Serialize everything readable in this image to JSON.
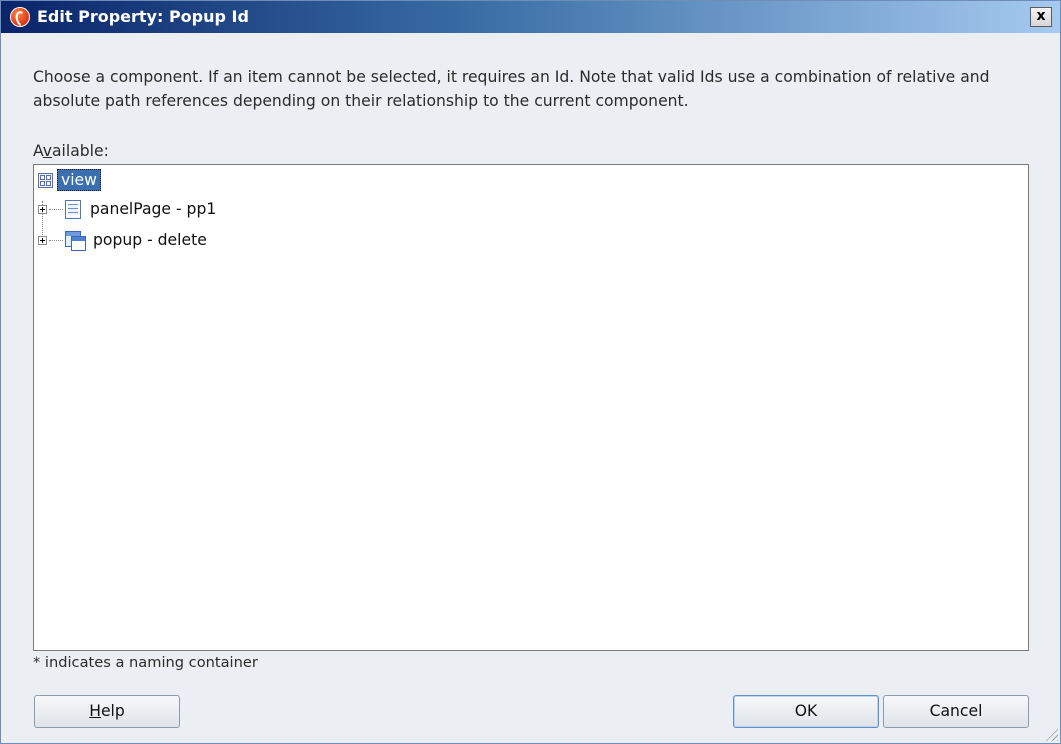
{
  "window": {
    "title": "Edit Property: Popup Id",
    "close_label": "x"
  },
  "description": "Choose a component. If an item cannot be selected, it requires an Id. Note that valid Ids use a combination of relative and absolute path references depending on their relationship to the current component.",
  "available": {
    "label_prefix": "A",
    "label_mnemonic": "v",
    "label_suffix": "ailable:"
  },
  "tree": {
    "root": {
      "label": "view",
      "icon": "view-grid-icon",
      "selected": true
    },
    "children": [
      {
        "label": "panelPage - pp1",
        "icon": "page-icon",
        "expandable": true
      },
      {
        "label": "popup - delete",
        "icon": "popup-icon",
        "expandable": true
      }
    ]
  },
  "footnote": "* indicates a naming container",
  "buttons": {
    "help_mnemonic": "H",
    "help_rest": "elp",
    "ok": "OK",
    "cancel": "Cancel"
  },
  "colors": {
    "titlebar_start": "#0a246a",
    "selection": "#3c6fb0"
  }
}
